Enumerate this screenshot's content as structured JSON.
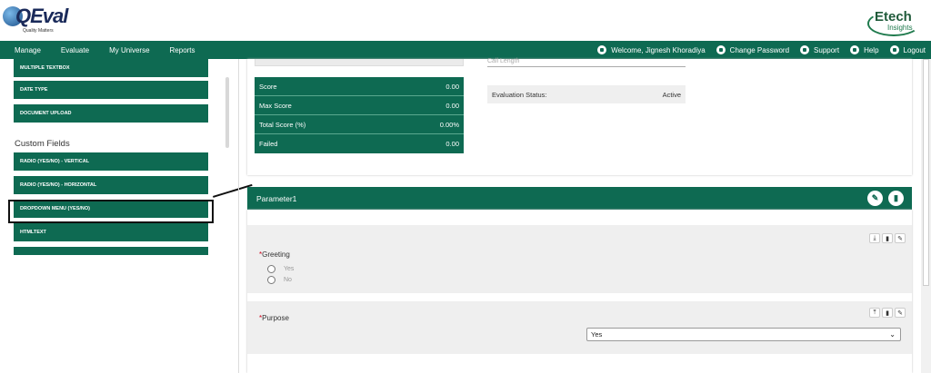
{
  "logos": {
    "left_brand": "QEval",
    "left_tagline": "Quality Matters",
    "right_brand": "Etech",
    "right_sub": "Insights"
  },
  "nav": {
    "menu": [
      "Manage",
      "Evaluate",
      "My Universe",
      "Reports"
    ],
    "welcome": "Welcome, Jignesh Khoradiya",
    "change_password": "Change Password",
    "support": "Support",
    "help": "Help",
    "logout": "Logout"
  },
  "sidebar": {
    "items_top": [
      "MULTIPLE TEXTBOX",
      "DATE TYPE",
      "DOCUMENT UPLOAD"
    ],
    "custom_fields_heading": "Custom Fields",
    "custom_fields": [
      "RADIO (YES/NO) - VERTICAL",
      "RADIO (YES/NO) - HORIZONTAL",
      "DROPDOWN MENU (YES/NO)",
      "HTMLTEXT"
    ]
  },
  "summary": {
    "call_length_placeholder": "Call Length",
    "rows": [
      {
        "label": "Score",
        "value": "0.00"
      },
      {
        "label": "Max Score",
        "value": "0.00"
      },
      {
        "label": "Total Score (%)",
        "value": "0.00%"
      },
      {
        "label": "Failed",
        "value": "0.00"
      }
    ],
    "eval_status_label": "Evaluation Status:",
    "eval_status_value": "Active"
  },
  "parameter": {
    "title": "Parameter1",
    "questions": [
      {
        "label": "Greeting",
        "required": "*",
        "options": [
          "Yes",
          "No"
        ]
      },
      {
        "label": "Purpose",
        "required": "*",
        "selected": "Yes"
      }
    ]
  },
  "colors": {
    "primary": "#0e6a52",
    "required": "#d0021b",
    "panel_gray": "#efefef"
  }
}
